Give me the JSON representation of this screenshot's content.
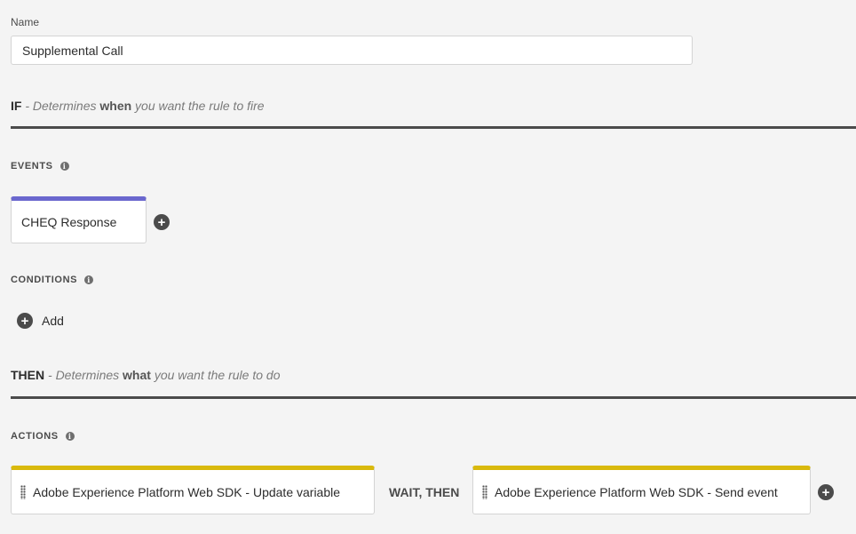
{
  "name_field": {
    "label": "Name",
    "value": "Supplemental Call"
  },
  "if_section": {
    "key": "IF",
    "desc_pre": " - Determines ",
    "desc_em": "when",
    "desc_post": " you want the rule to fire"
  },
  "events": {
    "heading": "EVENTS",
    "items": [
      {
        "label": "CHEQ Response",
        "accent_color": "#6a67ce"
      }
    ]
  },
  "conditions": {
    "heading": "CONDITIONS",
    "add_label": "Add"
  },
  "then_section": {
    "key": "THEN",
    "desc_pre": " - Determines ",
    "desc_em": "what",
    "desc_post": " you want the rule to do"
  },
  "actions": {
    "heading": "ACTIONS",
    "items": [
      {
        "label": "Adobe Experience Platform Web SDK - Update variable",
        "accent_color": "#d9b90c"
      },
      {
        "label": "Adobe Experience Platform Web SDK - Send event",
        "accent_color": "#d9b90c"
      }
    ],
    "sequence_label": "WAIT, THEN"
  },
  "icons": {
    "info": "info-icon",
    "add": "plus-circle-icon",
    "drag": "drag-handle-icon"
  }
}
